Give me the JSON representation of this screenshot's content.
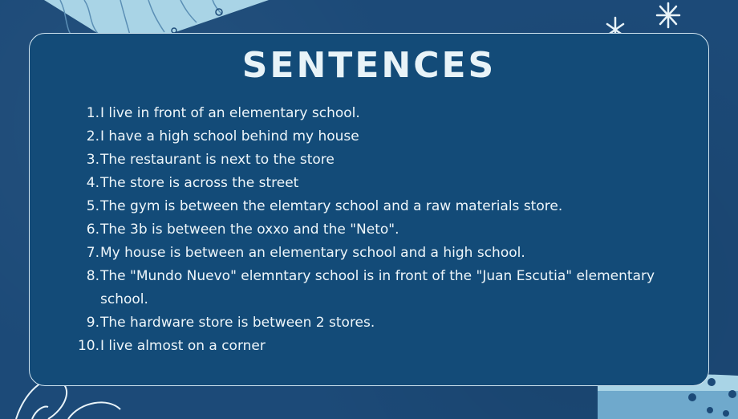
{
  "title": "SENTENCES",
  "sentences": [
    {
      "num": "1.",
      "text": "I live in front of an elementary school."
    },
    {
      "num": "2.",
      "text": "I have a high school behind my house"
    },
    {
      "num": "3.",
      "text": "The restaurant is next to the store"
    },
    {
      "num": "4.",
      "text": "The store is across the street"
    },
    {
      "num": "5.",
      "text": "The gym is between the elemtary school and a raw materials store."
    },
    {
      "num": "6.",
      "text": "The 3b is between the oxxo and the \"Neto\"."
    },
    {
      "num": "7.",
      "text": " My house is between an elementary school and a high school."
    },
    {
      "num": "8.",
      "text": "The \"Mundo Nuevo\" elemntary school is in front of the \"Juan Escutia\" elementary school."
    },
    {
      "num": "9.",
      "text": "The hardware store is between 2 stores."
    },
    {
      "num": "10.",
      "text": "I live almost on a corner"
    }
  ],
  "colors": {
    "background": "#1c4a78",
    "card": "#134b78",
    "text": "#eef6fa",
    "accent_light": "#a9d4e6"
  },
  "icons": [
    "sparkle-star-icon",
    "asterisk-star-icon",
    "leaf-outline-icon",
    "bowl-icon"
  ]
}
